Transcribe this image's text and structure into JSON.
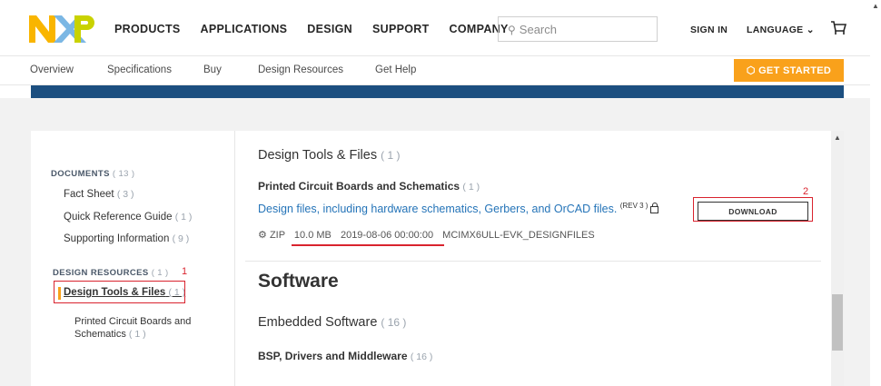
{
  "header": {
    "nav": [
      "PRODUCTS",
      "APPLICATIONS",
      "DESIGN",
      "SUPPORT",
      "COMPANY"
    ],
    "search_placeholder": "Search",
    "sign_in": "SIGN IN",
    "language": "LANGUAGE ⌄"
  },
  "subnav": {
    "items": [
      "Overview",
      "Specifications",
      "Buy",
      "Design Resources",
      "Get Help"
    ],
    "cta": "GET STARTED"
  },
  "sidebar": {
    "documents_label": "DOCUMENTS",
    "documents_count": "( 13 )",
    "docs": [
      {
        "label": "Fact Sheet",
        "count": "( 3 )"
      },
      {
        "label": "Quick Reference Guide",
        "count": "( 1 )"
      },
      {
        "label": "Supporting Information",
        "count": "( 9 )"
      }
    ],
    "design_label": "DESIGN RESOURCES",
    "design_count": "( 1 )",
    "annotation_1": "1",
    "selected_label": "Design Tools & Files",
    "selected_count": "( 1 )",
    "sub_label_line1": "Printed Circuit Boards and",
    "sub_label_line2": "Schematics",
    "sub_count": "( 1 )"
  },
  "main": {
    "section_title": "Design Tools & Files",
    "section_count": "( 1 )",
    "pcb_title": "Printed Circuit Boards and Schematics",
    "pcb_count": "( 1 )",
    "file_link": "Design files, including hardware schematics, Gerbers, and OrCAD files.",
    "rev": "(REV 3 )",
    "file_type": "ZIP",
    "file_size": "10.0 MB",
    "file_date": "2019-08-06 00:00:00",
    "file_name": "MCIMX6ULL-EVK_DESIGNFILES",
    "download_label": "DOWNLOAD",
    "annotation_2": "2",
    "software_title": "Software",
    "embedded_title": "Embedded Software",
    "embedded_count": "( 16 )",
    "bsp_title": "BSP, Drivers and Middleware",
    "bsp_count": "( 16 )"
  },
  "colors": {
    "accent_orange": "#f9a11b",
    "brand_blue": "#1c4f80",
    "link_blue": "#2574b8",
    "annotation_red": "#d9232e"
  }
}
